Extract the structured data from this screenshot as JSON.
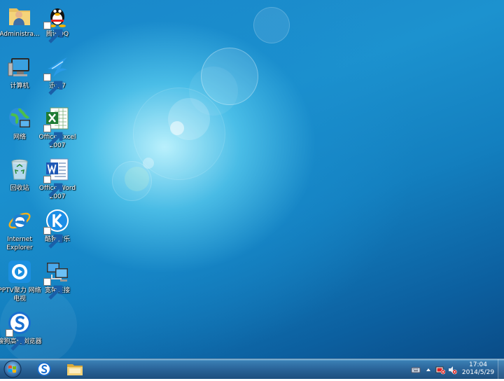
{
  "desktop": {
    "icons": [
      {
        "label": "Administra...",
        "icon": "user-folder-icon"
      },
      {
        "label": "腾讯QQ",
        "icon": "qq-penguin-icon"
      },
      {
        "label": "计算机",
        "icon": "computer-icon"
      },
      {
        "label": "迅雷7",
        "icon": "thunder-bird-icon"
      },
      {
        "label": "网络",
        "icon": "network-globe-icon"
      },
      {
        "label": "Office Excel 2007",
        "icon": "excel-icon"
      },
      {
        "label": "回收站",
        "icon": "recycle-bin-icon"
      },
      {
        "label": "Office Word 2007",
        "icon": "word-icon"
      },
      {
        "label": "Internet Explorer",
        "icon": "internet-explorer-icon"
      },
      {
        "label": "酷狗音乐",
        "icon": "kugou-icon"
      },
      {
        "label": "PPTV聚力 网络电视",
        "icon": "pptv-icon"
      },
      {
        "label": "宽带连接",
        "icon": "broadband-connection-icon"
      },
      {
        "label": "搜狗高速浏览器",
        "icon": "sogou-browser-icon"
      }
    ]
  },
  "taskbar": {
    "pinned": [
      "sogou-browser-icon",
      "folder-icon"
    ],
    "tray": [
      "keyboard-icon",
      "show-hidden-icons-arrow",
      "flag-icon",
      "volume-muted-icon"
    ],
    "clock": {
      "time": "17:04",
      "date": "2014/5/29"
    }
  }
}
